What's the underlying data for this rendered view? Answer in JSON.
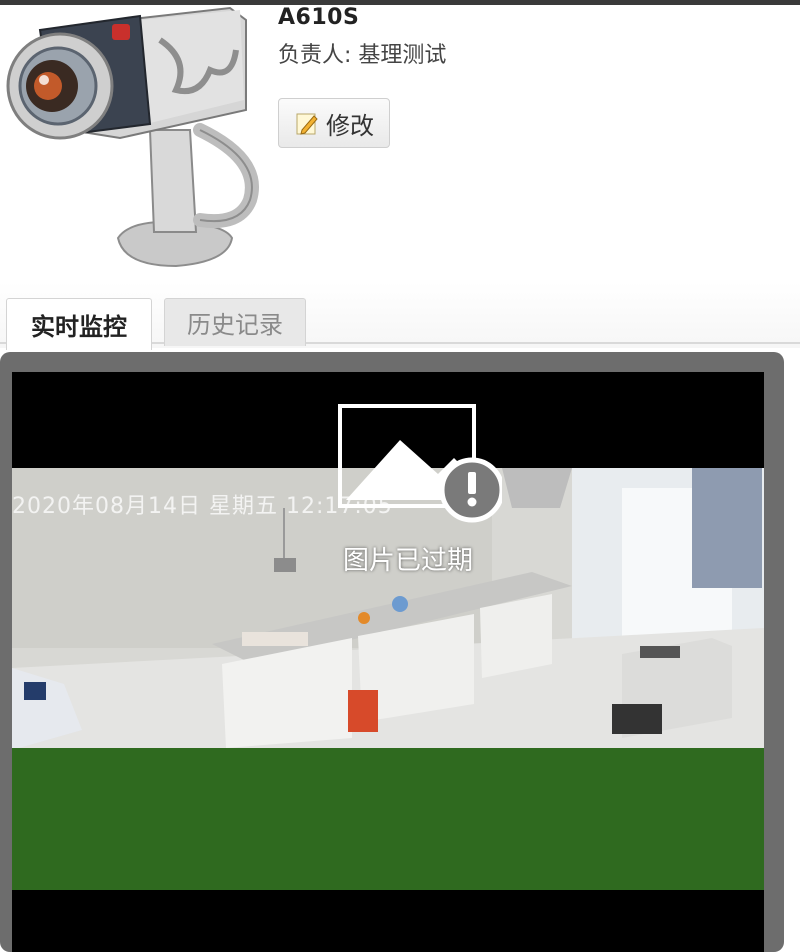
{
  "device": {
    "name": "A610S",
    "owner_line": "负责人: 基理测试",
    "edit_label": "修改",
    "icon": "security-camera-icon"
  },
  "tabs": [
    {
      "label": "实时监控",
      "active": true
    },
    {
      "label": "历史记录",
      "active": false
    }
  ],
  "video": {
    "osd_text": "2020年08月14日  星期五  12:17:05",
    "status_text": "图片已过期",
    "status_icon": "image-expired-icon",
    "colors": {
      "band": "#2f6a1f",
      "frame": "#6d6d6d"
    }
  }
}
